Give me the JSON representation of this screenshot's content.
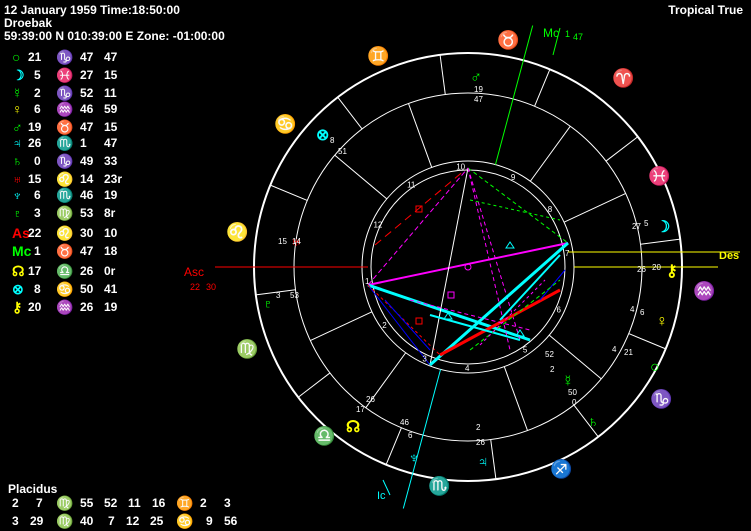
{
  "header": {
    "line1": "12 January 1959 Time:18:50:00",
    "line2": "Droebak",
    "line3": "59:39:00 N 010:39:00 E Zone: -01:00:00",
    "mode": "Tropical True"
  },
  "planets": [
    {
      "glyph": "○",
      "icon": "sun-icon",
      "color": "#00ff00",
      "deg": "21",
      "sign": "♑",
      "sign_color": "#00ff00",
      "min": "47",
      "sec": "47"
    },
    {
      "glyph": "☽",
      "icon": "moon-icon",
      "color": "#00ffff",
      "deg": "5",
      "sign": "♓",
      "sign_color": "#00ffff",
      "min": "27",
      "sec": "15"
    },
    {
      "glyph": "☿",
      "icon": "mercury-icon",
      "color": "#00ff00",
      "deg": "2",
      "sign": "♑",
      "sign_color": "#00ff00",
      "min": "52",
      "sec": "11"
    },
    {
      "glyph": "♀",
      "icon": "venus-icon",
      "color": "#ffff00",
      "deg": "6",
      "sign": "♒",
      "sign_color": "#ffff00",
      "min": "46",
      "sec": "59"
    },
    {
      "glyph": "♂",
      "icon": "mars-icon",
      "color": "#00ff00",
      "deg": "19",
      "sign": "♉",
      "sign_color": "#00ff00",
      "min": "47",
      "sec": "15"
    },
    {
      "glyph": "♃",
      "icon": "jupiter-icon",
      "color": "#00ffff",
      "deg": "26",
      "sign": "♏",
      "sign_color": "#00ffff",
      "min": "1",
      "sec": "47"
    },
    {
      "glyph": "♄",
      "icon": "saturn-icon",
      "color": "#00ff00",
      "deg": "0",
      "sign": "♑",
      "sign_color": "#00ff00",
      "min": "49",
      "sec": "33"
    },
    {
      "glyph": "♅",
      "icon": "uranus-icon",
      "color": "#ff0000",
      "deg": "15",
      "sign": "♌",
      "sign_color": "#ff0000",
      "min": "14",
      "sec": "23r"
    },
    {
      "glyph": "♆",
      "icon": "neptune-icon",
      "color": "#00ffff",
      "deg": "6",
      "sign": "♏",
      "sign_color": "#00ffff",
      "min": "46",
      "sec": "19"
    },
    {
      "glyph": "♇",
      "icon": "pluto-icon",
      "color": "#00ff00",
      "deg": "3",
      "sign": "♍",
      "sign_color": "#00ff00",
      "min": "53",
      "sec": "8r"
    },
    {
      "glyph": "As",
      "icon": "ascendant-icon",
      "color": "#ff0000",
      "deg": "22",
      "sign": "♌",
      "sign_color": "#ff0000",
      "min": "30",
      "sec": "10"
    },
    {
      "glyph": "Mc",
      "icon": "midheaven-icon",
      "color": "#00ff00",
      "deg": "1",
      "sign": "♉",
      "sign_color": "#00ff00",
      "min": "47",
      "sec": "18"
    },
    {
      "glyph": "☊",
      "icon": "node-icon",
      "color": "#ffff00",
      "deg": "17",
      "sign": "♎",
      "sign_color": "#ffff00",
      "min": "26",
      "sec": "0r"
    },
    {
      "glyph": "⊗",
      "icon": "fortune-icon",
      "color": "#00ffff",
      "deg": "8",
      "sign": "♋",
      "sign_color": "#00ffff",
      "min": "50",
      "sec": "41"
    },
    {
      "glyph": "⚷",
      "icon": "chiron-icon",
      "color": "#ffff00",
      "deg": "20",
      "sign": "♒",
      "sign_color": "#ffff00",
      "min": "26",
      "sec": "19"
    }
  ],
  "houses": {
    "system": "Placidus",
    "row1": {
      "a": "2",
      "b": "7",
      "c": "♍",
      "c_color": "#00ff00",
      "d": "55",
      "e": "52",
      "f": "11",
      "g": "16",
      "h": "♊",
      "h_color": "#ffff00",
      "i": "2",
      "j": "3"
    },
    "row2": {
      "a": "3",
      "b": "29",
      "c": "♍",
      "c_color": "#00ff00",
      "d": "40",
      "e": "7",
      "f": "12",
      "g": "25",
      "h": "♋",
      "h_color": "#00ffff",
      "i": "9",
      "j": "56"
    }
  },
  "wheel_labels": {
    "asc": "Asc",
    "asc_deg": "22",
    "asc_min": "30",
    "desc": "Des",
    "mc": "Mc",
    "mc_deg": "1",
    "mc_min": "47",
    "ic": "Ic"
  },
  "house_numbers": [
    "1",
    "2",
    "3",
    "4",
    "5",
    "6",
    "7",
    "8",
    "9",
    "10",
    "11",
    "12"
  ],
  "zodiac_ring": {
    "taurus": "♉",
    "aries": "♈",
    "pisces": "♓",
    "aquarius": "♒",
    "capricorn": "♑",
    "sagittarius": "♐",
    "scorpio": "♏",
    "libra": "♎",
    "virgo": "♍",
    "leo": "♌",
    "cancer": "♋",
    "gemini": "♊"
  },
  "chart_planets": [
    {
      "glyph": "♂",
      "color": "#00ff00",
      "deg": "19",
      "min": "47"
    },
    {
      "glyph": "⊗",
      "color": "#00ffff",
      "deg": "8",
      "min": "51"
    },
    {
      "glyph": "♅",
      "color": "#ff0000",
      "deg": "15",
      "min": "14"
    },
    {
      "glyph": "♇",
      "color": "#00ff00",
      "deg": "3",
      "min": "53"
    },
    {
      "glyph": "☽",
      "color": "#00ffff",
      "deg": "27",
      "min": "5"
    },
    {
      "glyph": "⚷",
      "color": "#ffff00",
      "deg": "26",
      "min": "20"
    },
    {
      "glyph": "♀",
      "color": "#ffff00",
      "deg": "4",
      "min": "6"
    },
    {
      "glyph": "○",
      "color": "#00ff00",
      "deg": "4",
      "min": "21"
    },
    {
      "glyph": "☿",
      "color": "#00ff00",
      "deg": "52",
      "min": "2"
    },
    {
      "glyph": "♄",
      "color": "#00ff00",
      "deg": "50",
      "min": "0"
    },
    {
      "glyph": "♃",
      "color": "#00ffff",
      "deg": "2",
      "min": "26"
    },
    {
      "glyph": "♆",
      "color": "#00ffff",
      "deg": "46",
      "min": "6"
    },
    {
      "glyph": "☊",
      "color": "#ffff00",
      "deg": "26",
      "min": "17"
    }
  ]
}
